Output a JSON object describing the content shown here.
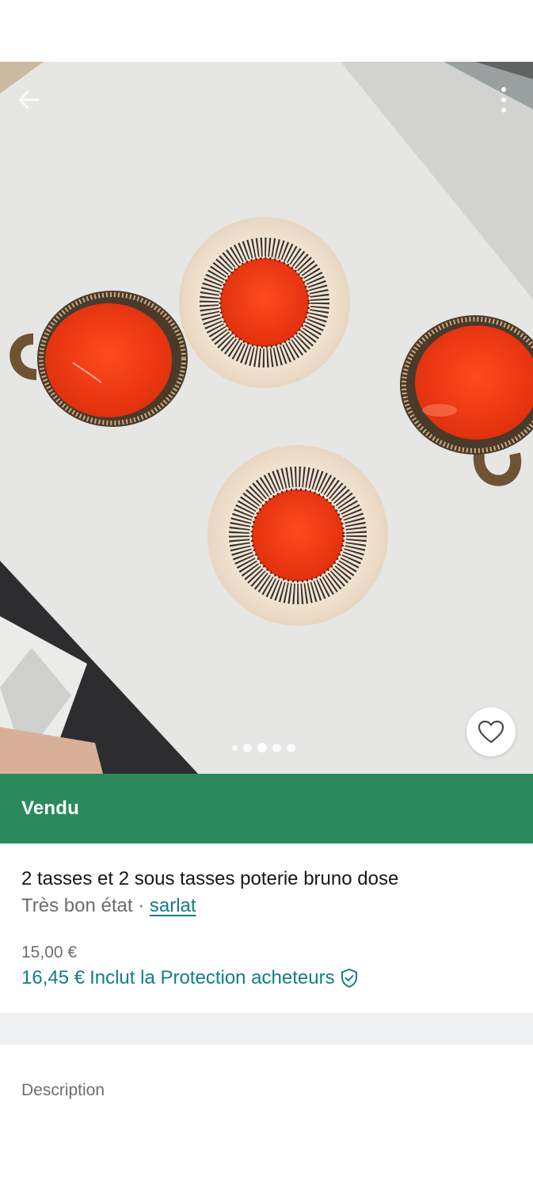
{
  "icons": {
    "back": "arrow-left-icon",
    "more": "more-vertical-icon",
    "favorite": "heart-icon",
    "protection": "shield-check-icon"
  },
  "colors": {
    "accent_green": "#2b8a5b",
    "link_teal": "#137d87",
    "muted_text": "#6d6d6d"
  },
  "gallery": {
    "image_count": 5,
    "active_index": 2
  },
  "status": {
    "label": "Vendu"
  },
  "item": {
    "title": "2 tasses et 2 sous tasses poterie bruno dose",
    "condition": "Très bon état",
    "separator": " · ",
    "seller": "sarlat",
    "price": "15,00 €",
    "price_with_protection": "16,45 €",
    "protection_label": "Inclut la Protection acheteurs"
  },
  "description": {
    "title": "Description"
  }
}
